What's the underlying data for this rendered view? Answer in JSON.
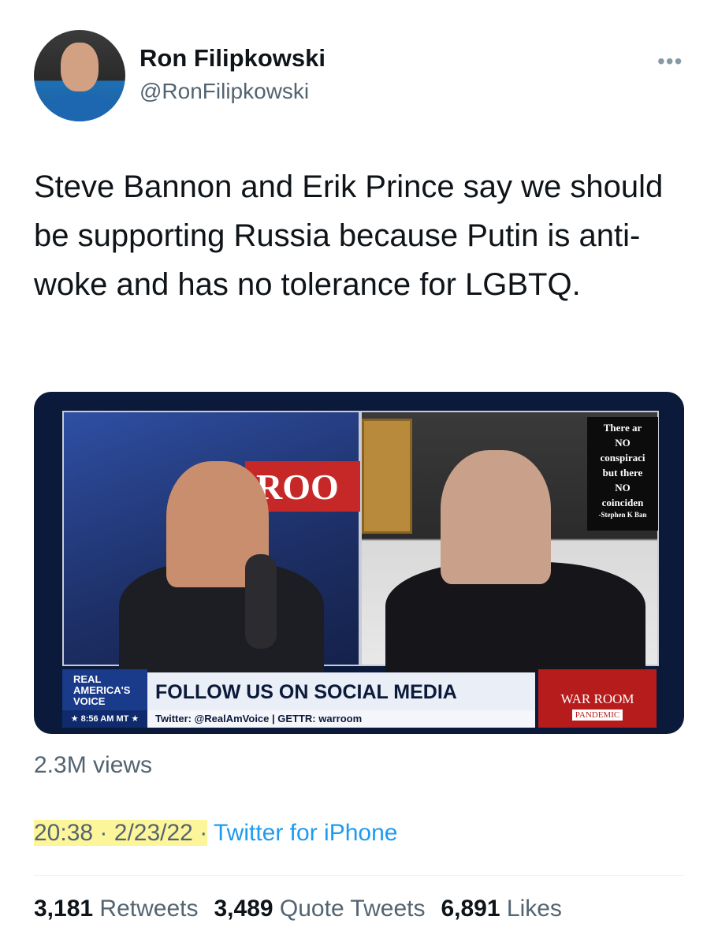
{
  "author": {
    "name": "Ron Filipkowski",
    "handle": "@RonFilipkowski"
  },
  "more_icon": "more-horizontal-icon",
  "tweet": {
    "text": "Steve Bannon and Erik Prince say we should be supporting Russia because Putin is anti-woke and has no tolerance for LGBTQ."
  },
  "media": {
    "left_banner": "ROO",
    "sign_lines": [
      "There ar",
      "NO",
      "conspiraci",
      "but there",
      "NO",
      "coinciden",
      "-Stephen K Ban"
    ],
    "network_line1": "REAL",
    "network_line2": "AMERICA'S",
    "network_line3": "VOICE",
    "clock": "★ 8:56 AM MT ★",
    "headline": "FOLLOW US ON SOCIAL MEDIA",
    "subline": "Twitter: @RealAmVoice | GETTR: warroom",
    "show_title": "WAR ROOM",
    "show_subtitle": "PANDEMIC"
  },
  "views": "2.3M views",
  "meta": {
    "time": "20:38",
    "separator": "·",
    "date": "2/23/22",
    "source": "Twitter for iPhone"
  },
  "stats": {
    "retweets_count": "3,181",
    "retweets_label": "Retweets",
    "quotes_count": "3,489",
    "quotes_label": "Quote Tweets",
    "likes_count": "6,891",
    "likes_label": "Likes"
  },
  "colors": {
    "link": "#1d9bf0",
    "secondary_text": "#536471",
    "highlight": "#fdf59a"
  }
}
